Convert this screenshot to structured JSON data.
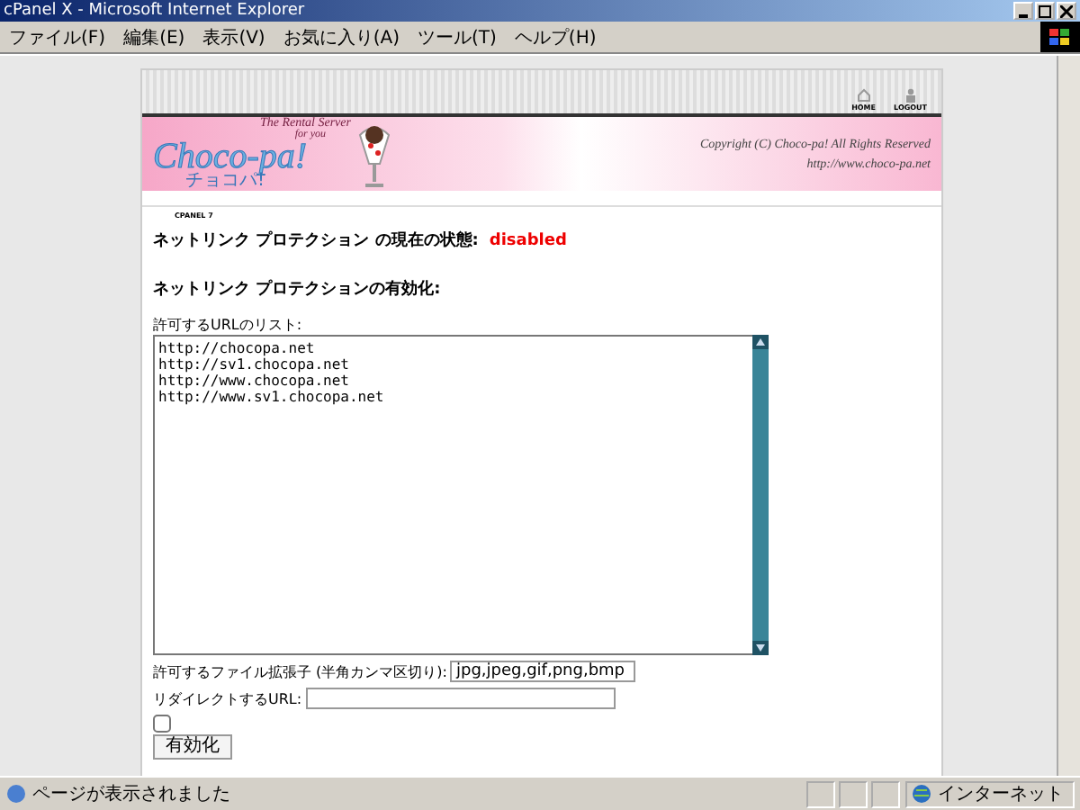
{
  "window": {
    "title": "cPanel X - Microsoft Internet Explorer"
  },
  "menu": [
    "ファイル(F)",
    "編集(E)",
    "表示(V)",
    "お気に入り(A)",
    "ツール(T)",
    "ヘルプ(H)"
  ],
  "header": {
    "nav": [
      "HOME",
      "LOGOUT"
    ],
    "tagline": "The Rental Server",
    "tagline_2": "for you",
    "logo": "Choco-pa!",
    "logo_kana": "チョコパ!",
    "copyright": "Copyright (C) Choco-pa! All Rights Reserved",
    "url": "http://www.choco-pa.net",
    "breadcrumb": "CPANEL 7"
  },
  "status_line": {
    "label": "ネットリンク プロテクション の現在の状態:",
    "value": "disabled"
  },
  "section_heading": "ネットリンク プロテクションの有効化:",
  "url_list": {
    "label": "許可するURLのリスト:",
    "value": "http://chocopa.net\nhttp://sv1.chocopa.net\nhttp://www.chocopa.net\nhttp://www.sv1.chocopa.net"
  },
  "extensions": {
    "label": "許可するファイル拡張子 (半角カンマ区切り):",
    "value": "jpg,jpeg,gif,png,bmp"
  },
  "redirect": {
    "label": "リダイレクトするURL:"
  },
  "checkbox": {
    "checked": false
  },
  "submit_button": "有効化",
  "status_bar": {
    "text": "ページが表示されました",
    "zone": "インターネット"
  }
}
